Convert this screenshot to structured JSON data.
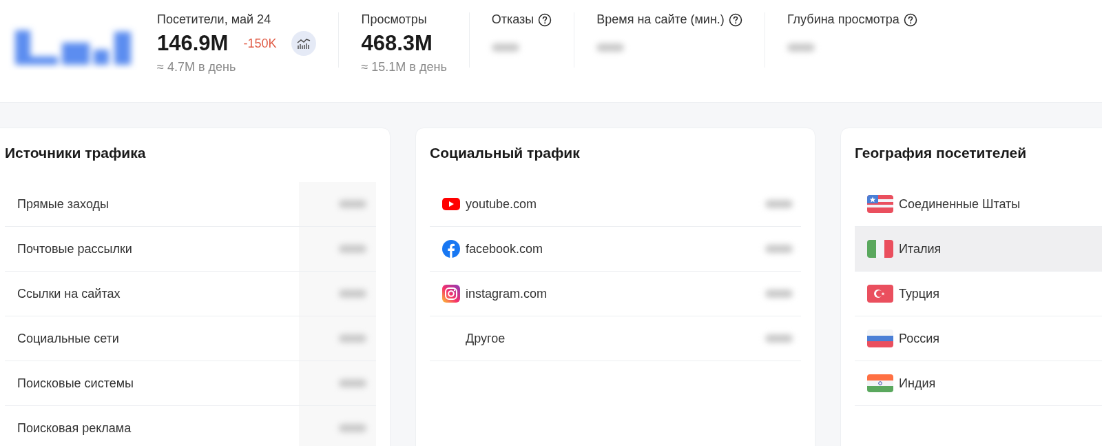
{
  "header": {
    "stats": [
      {
        "kind": "main",
        "label": "Посетители, май 24",
        "value": "146.9M",
        "delta": "-150K",
        "per_day": "≈ 4.7M в день"
      },
      {
        "kind": "plain",
        "label": "Просмотры",
        "value": "468.3M",
        "per_day": "≈ 15.1M в день"
      },
      {
        "kind": "hidden",
        "label": "Отказы"
      },
      {
        "kind": "hidden",
        "label": "Время на сайте (мин.)"
      },
      {
        "kind": "hidden",
        "label": "Глубина просмотра"
      }
    ]
  },
  "traffic_sources": {
    "title": "Источники трафика",
    "items": [
      {
        "label": "Прямые заходы"
      },
      {
        "label": "Почтовые рассылки"
      },
      {
        "label": "Ссылки на сайтах"
      },
      {
        "label": "Социальные сети"
      },
      {
        "label": "Поисковые системы"
      },
      {
        "label": "Поисковая реклама"
      }
    ]
  },
  "social_traffic": {
    "title": "Социальный трафик",
    "items": [
      {
        "label": "youtube.com",
        "kind": "youtube"
      },
      {
        "label": "facebook.com",
        "kind": "facebook"
      },
      {
        "label": "instagram.com",
        "kind": "instagram"
      },
      {
        "label": "Другое",
        "kind": "other"
      }
    ]
  },
  "geography": {
    "title": "География посетителей",
    "items": [
      {
        "label": "Соединенные Штаты",
        "kind": "us",
        "highlighted": false
      },
      {
        "label": "Италия",
        "kind": "it",
        "highlighted": true
      },
      {
        "label": "Турция",
        "kind": "tr",
        "highlighted": false
      },
      {
        "label": "Россия",
        "kind": "ru",
        "highlighted": false
      },
      {
        "label": "Индия",
        "kind": "in",
        "highlighted": false
      }
    ]
  }
}
